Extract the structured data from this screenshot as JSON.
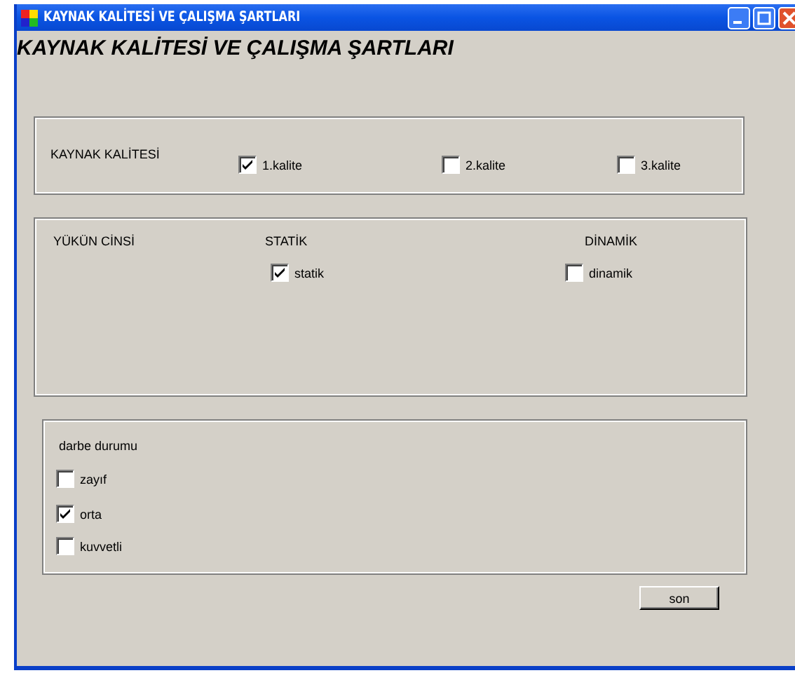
{
  "window": {
    "title": "KAYNAK KALİTESİ VE ÇALIŞMA ŞARTLARI"
  },
  "heading": "KAYNAK KALİTESİ VE ÇALIŞMA ŞARTLARI",
  "kaynak_kalitesi": {
    "label": "KAYNAK KALİTESİ",
    "options": [
      {
        "label": "1.kalite",
        "checked": true
      },
      {
        "label": "2.kalite",
        "checked": false
      },
      {
        "label": "3.kalite",
        "checked": false
      }
    ]
  },
  "yukun_cinsi": {
    "label": "YÜKÜN CİNSİ",
    "columns": [
      {
        "heading": "STATİK",
        "option": {
          "label": "statik",
          "checked": true
        }
      },
      {
        "heading": "DİNAMİK",
        "option": {
          "label": "dinamik",
          "checked": false
        }
      }
    ]
  },
  "darbe_durumu": {
    "label": "darbe durumu",
    "options": [
      {
        "label": "zayıf",
        "checked": false
      },
      {
        "label": "orta",
        "checked": true
      },
      {
        "label": "kuvvetli",
        "checked": false
      }
    ]
  },
  "buttons": [
    "son"
  ]
}
